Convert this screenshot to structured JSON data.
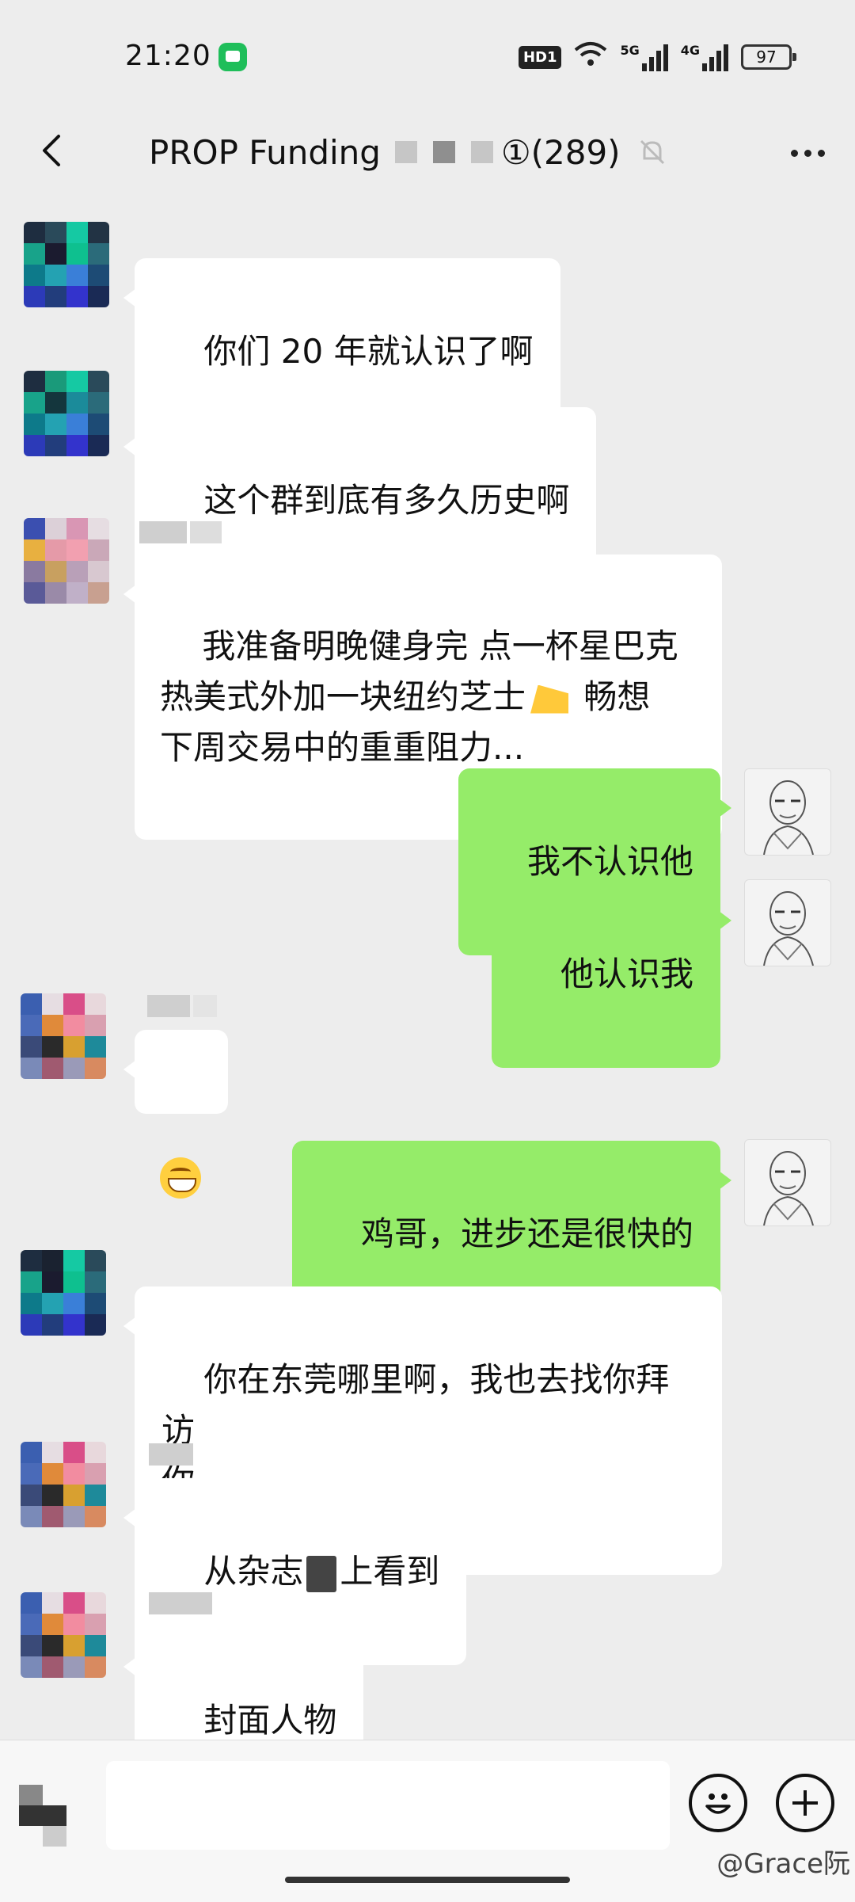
{
  "status_bar": {
    "time": "21:20",
    "network_badges": [
      "HD1",
      "5G",
      "4G"
    ],
    "battery": "97"
  },
  "header": {
    "title": "PROP Funding",
    "title_suffix": "①(289)"
  },
  "messages": [
    {
      "side": "left",
      "sender": "",
      "text": "你们 20 年就认识了啊"
    },
    {
      "side": "left",
      "sender": "",
      "text": "这个群到底有多久历史啊"
    },
    {
      "side": "left",
      "sender": "",
      "text_parts": [
        "我准备明晚健身完 点一杯星巴克\n热美式外加一块纽约芝士",
        " 畅想\n下周交易中的重重阻力..."
      ]
    },
    {
      "side": "right",
      "text": "我不认识他"
    },
    {
      "side": "right",
      "text": "他认识我"
    },
    {
      "side": "left",
      "sender": "",
      "emoji": "grinning-face"
    },
    {
      "side": "right",
      "text": "鸡哥，进步还是很快的"
    },
    {
      "side": "left",
      "sender": "",
      "text": "你在东莞哪里啊，我也去找你拜访\n你"
    },
    {
      "side": "left",
      "sender": "",
      "text_parts": [
        "从杂志",
        "上看到"
      ]
    },
    {
      "side": "left",
      "sender": "",
      "text": "封面人物"
    }
  ],
  "input": {
    "placeholder": "",
    "watermark": "@Grace阮"
  },
  "colors": {
    "background": "#ededed",
    "self_bubble": "#95ec69",
    "other_bubble": "#ffffff",
    "app_badge": "#1fbe5a"
  },
  "icons": [
    "back-arrow-icon",
    "mute-bell-icon",
    "more-dots-icon",
    "voice-icon",
    "emoji-icon",
    "plus-icon"
  ]
}
